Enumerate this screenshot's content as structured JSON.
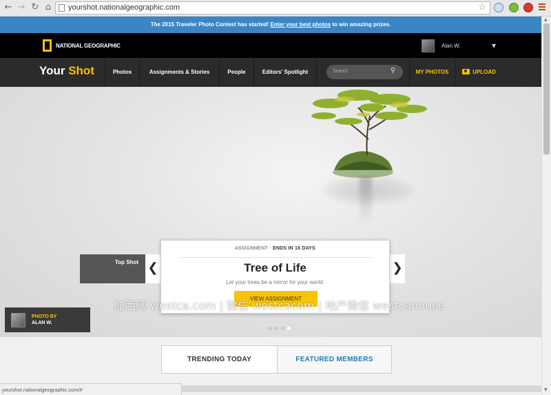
{
  "browser": {
    "url": "yourshot.nationalgeographic.com",
    "status_url": "yourshot.nationalgeographic.com/#"
  },
  "announcement": {
    "prefix": "The 2015 Traveler Photo Contest has started! ",
    "link": "Enter your best photos",
    "suffix": " to win amazing prizes."
  },
  "header": {
    "brand": "NATIONAL GEOGRAPHIC",
    "user_name": "Alan W."
  },
  "nav": {
    "brand_your": "Your",
    "brand_shot": "Shot",
    "tabs": [
      "Photos",
      "Assignments & Stories",
      "People",
      "Editors' Spotlight"
    ],
    "search_placeholder": "Search",
    "my_photos": "MY PHOTOS",
    "upload": "UPLOAD"
  },
  "hero": {
    "top_shot": "Top Shot",
    "assignment_label": "ASSIGNMENT - ",
    "ends_in": "ENDS IN 16 DAYS",
    "title": "Tree of Life",
    "subtitle": "Let your trees be a mirror for your world.",
    "cta": "VIEW ASSIGNMENT",
    "photo_by": "PHOTO BY",
    "photographer": "ALAN W.",
    "slide_count": 4,
    "active_slide": 4,
    "watermark": "加西网 westca.com | 微信 westcacom | 地产微信 westcahouse"
  },
  "section_tabs": [
    "TRENDING TODAY",
    "FEATURED MEMBERS"
  ],
  "colors": {
    "accent": "#f8c300",
    "announce_bg": "#3a85c6",
    "link_blue": "#1e7bb6"
  }
}
